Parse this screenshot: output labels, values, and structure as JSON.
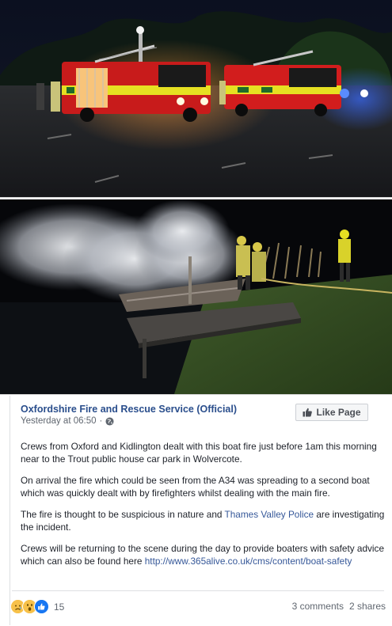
{
  "post": {
    "page_name": "Oxfordshire Fire and Rescue Service (Official)",
    "timestamp": "Yesterday at 06:50",
    "separator": "·",
    "privacy_icon": "globe-icon",
    "like_page_label": "Like Page",
    "paragraphs": {
      "p1": "Crews from Oxford and Kidlington dealt with this boat fire just before 1am this morning near to the Trout public house car park in Wolvercote.",
      "p2": "On arrival the fire which could be seen from the A34 was spreading to a second boat which was quickly dealt with by firefighters whilst dealing with the main fire.",
      "p3_before": "The fire is thought to be suspicious in nature and ",
      "p3_link": "Thames Valley Police",
      "p3_after": " are investigating the incident.",
      "p4_before": "Crews will be returning to the scene during the day to provide boaters with safety advice which can also be found here ",
      "p4_link": "http://www.365alive.co.uk/cms/content/boat-safety"
    }
  },
  "footer": {
    "reaction_icons": [
      "sad-reaction-icon",
      "wow-reaction-icon",
      "like-reaction-icon"
    ],
    "reaction_count": "15",
    "comments": "3 comments",
    "shares": "2 shares"
  },
  "colors": {
    "link": "#365899",
    "page_name": "#2a4e8c",
    "fire_engine_red": "#d81e1e",
    "hi_vis_yellow": "#e6e022",
    "like_blue": "#1877f2"
  }
}
